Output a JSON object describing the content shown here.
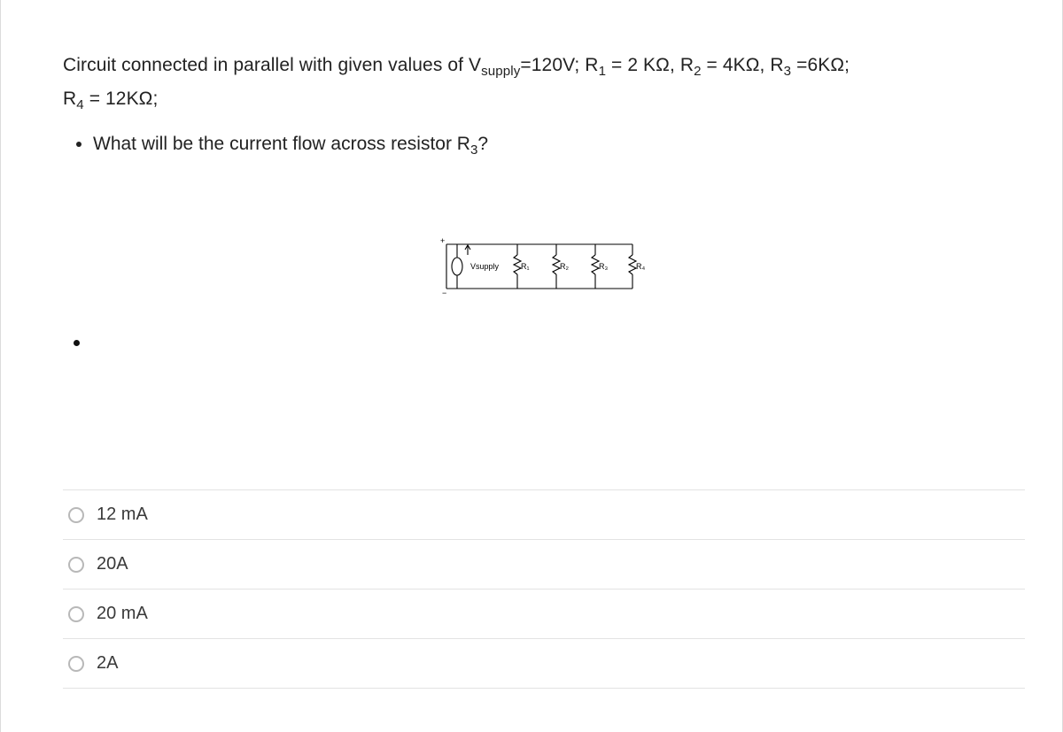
{
  "prompt": {
    "line1": "Circuit connected in parallel with given values of V",
    "l1_sub": "supply",
    "l1_after": "=120V; R",
    "r1sub": "1",
    "r1after": " = 2 KΩ, R",
    "r2sub": "2",
    "r2after": " = 4KΩ,  R",
    "r3sub": "3",
    "r3after": " =6KΩ;",
    "line2_before": "R",
    "r4sub": "4",
    "line2_after": " = 12KΩ;",
    "bullet_before": "What will be the current flow across resistor R",
    "bullet_sub": "3",
    "bullet_after": "?"
  },
  "circuit": {
    "vsupply_label": "Vsupply",
    "r_labels": [
      "R₁",
      "R₂",
      "R₃",
      "R₄"
    ],
    "plus": "+",
    "minus": "−"
  },
  "answers": [
    "12 mA",
    "20A",
    "20 mA",
    "2A"
  ]
}
